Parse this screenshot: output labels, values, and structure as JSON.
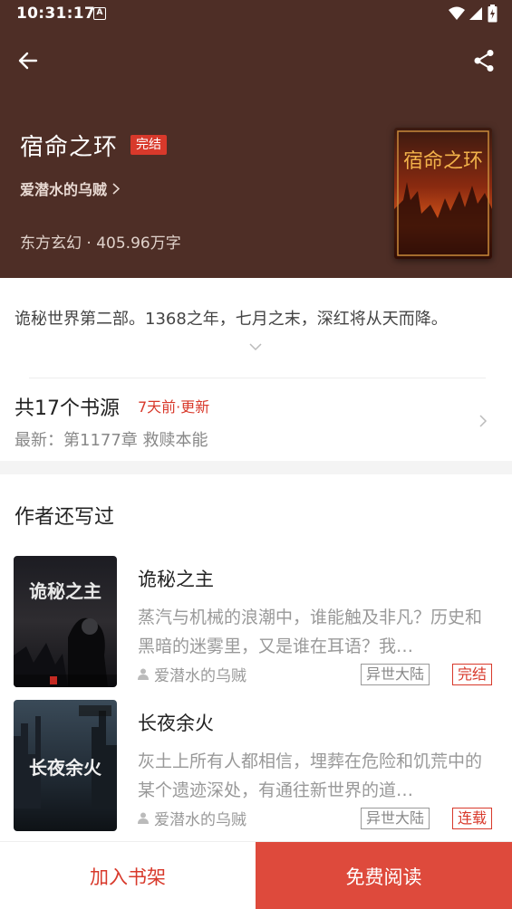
{
  "status_bar": {
    "time": "10:31:17",
    "notif_icon": "A"
  },
  "header": {
    "back_icon": "arrow-left-icon",
    "share_icon": "share-icon",
    "book_title": "宿命之环",
    "status_tag": "完结",
    "author": "爱潜水的乌贼",
    "meta": "东方玄幻 · 405.96万字",
    "cover_title": "宿命之环",
    "background_color": "#4e2e26"
  },
  "description": {
    "text": "诡秘世界第二部。1368之年，七月之末，深红将从天而降。"
  },
  "sources": {
    "count_label": "共17个书源",
    "updated_label": "7天前·更新",
    "latest_label": "最新：第1177章 救赎本能"
  },
  "author_books": {
    "section_title": "作者还写过",
    "items": [
      {
        "name": "诡秘之主",
        "blurb": "蒸汽与机械的浪潮中，谁能触及非凡？历史和黑暗的迷雾里，又是谁在耳语？我…",
        "author": "爱潜水的乌贼",
        "genre": "异世大陆",
        "state": "完结",
        "cover_title": "诡秘之主"
      },
      {
        "name": "长夜余火",
        "blurb": "灰土上所有人都相信，埋葬在危险和饥荒中的某个遗迹深处，有通往新世界的道…",
        "author": "爱潜水的乌贼",
        "genre": "异世大陆",
        "state": "连载",
        "cover_title": "长夜余火"
      }
    ]
  },
  "bottom_bar": {
    "add_shelf": "加入书架",
    "read_free": "免费阅读"
  },
  "colors": {
    "accent": "#d8392b",
    "primary_button": "#de4a3c"
  }
}
